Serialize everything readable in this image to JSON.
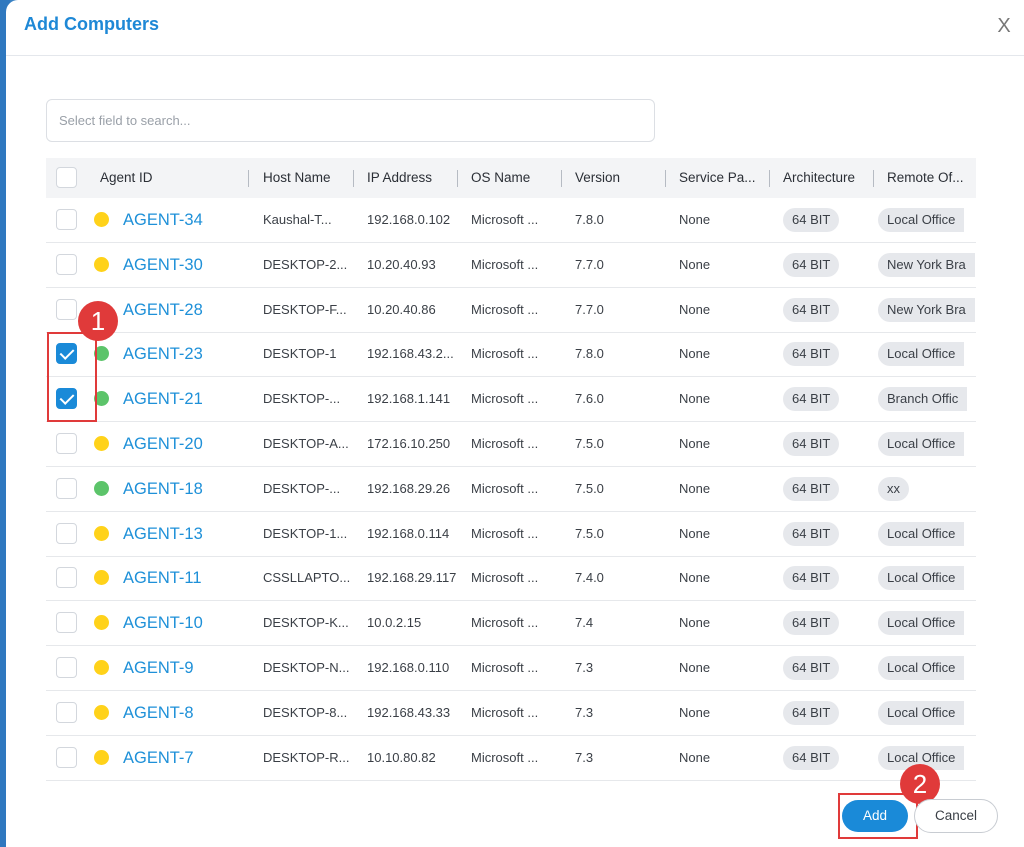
{
  "dialog": {
    "title": "Add Computers",
    "close_glyph": "X"
  },
  "search": {
    "placeholder": "Select field to search..."
  },
  "columns": [
    "Agent ID",
    "Host Name",
    "IP Address",
    "OS Name",
    "Version",
    "Service Pa...",
    "Architecture",
    "Remote Of..."
  ],
  "colors": {
    "online": "#5cc46a",
    "away": "#ffd21a",
    "accent": "#1a8ad8",
    "annotation": "#e03a3a"
  },
  "rows": [
    {
      "agent": "AGENT-34",
      "status": "away",
      "checked": false,
      "host": "Kaushal-T...",
      "ip": "192.168.0.102",
      "os": "Microsoft ...",
      "version": "7.8.0",
      "sp": "None",
      "arch": "64 BIT",
      "remote": "Local Office"
    },
    {
      "agent": "AGENT-30",
      "status": "away",
      "checked": false,
      "host": "DESKTOP-2...",
      "ip": "10.20.40.93",
      "os": "Microsoft ...",
      "version": "7.7.0",
      "sp": "None",
      "arch": "64 BIT",
      "remote": "New York Bra"
    },
    {
      "agent": "AGENT-28",
      "status": "away",
      "checked": false,
      "host": "DESKTOP-F...",
      "ip": "10.20.40.86",
      "os": "Microsoft ...",
      "version": "7.7.0",
      "sp": "None",
      "arch": "64 BIT",
      "remote": "New York Bra"
    },
    {
      "agent": "AGENT-23",
      "status": "online",
      "checked": true,
      "host": "DESKTOP-1",
      "ip": "192.168.43.2...",
      "os": "Microsoft ...",
      "version": "7.8.0",
      "sp": "None",
      "arch": "64 BIT",
      "remote": "Local Office"
    },
    {
      "agent": "AGENT-21",
      "status": "online",
      "checked": true,
      "host": "DESKTOP-...",
      "ip": "192.168.1.141",
      "os": "Microsoft ...",
      "version": "7.6.0",
      "sp": "None",
      "arch": "64 BIT",
      "remote": "Branch Offic"
    },
    {
      "agent": "AGENT-20",
      "status": "away",
      "checked": false,
      "host": "DESKTOP-A...",
      "ip": "172.16.10.250",
      "os": "Microsoft ...",
      "version": "7.5.0",
      "sp": "None",
      "arch": "64 BIT",
      "remote": "Local Office"
    },
    {
      "agent": "AGENT-18",
      "status": "online",
      "checked": false,
      "host": "DESKTOP-...",
      "ip": "192.168.29.26",
      "os": "Microsoft ...",
      "version": "7.5.0",
      "sp": "None",
      "arch": "64 BIT",
      "remote": "xx"
    },
    {
      "agent": "AGENT-13",
      "status": "away",
      "checked": false,
      "host": "DESKTOP-1...",
      "ip": "192.168.0.114",
      "os": "Microsoft ...",
      "version": "7.5.0",
      "sp": "None",
      "arch": "64 BIT",
      "remote": "Local Office"
    },
    {
      "agent": "AGENT-11",
      "status": "away",
      "checked": false,
      "host": "CSSLLAPTO...",
      "ip": "192.168.29.117",
      "os": "Microsoft ...",
      "version": "7.4.0",
      "sp": "None",
      "arch": "64 BIT",
      "remote": "Local Office"
    },
    {
      "agent": "AGENT-10",
      "status": "away",
      "checked": false,
      "host": "DESKTOP-K...",
      "ip": "10.0.2.15",
      "os": "Microsoft ...",
      "version": "7.4",
      "sp": "None",
      "arch": "64 BIT",
      "remote": "Local Office"
    },
    {
      "agent": "AGENT-9",
      "status": "away",
      "checked": false,
      "host": "DESKTOP-N...",
      "ip": "192.168.0.110",
      "os": "Microsoft ...",
      "version": "7.3",
      "sp": "None",
      "arch": "64 BIT",
      "remote": "Local Office"
    },
    {
      "agent": "AGENT-8",
      "status": "away",
      "checked": false,
      "host": "DESKTOP-8...",
      "ip": "192.168.43.33",
      "os": "Microsoft ...",
      "version": "7.3",
      "sp": "None",
      "arch": "64 BIT",
      "remote": "Local Office"
    },
    {
      "agent": "AGENT-7",
      "status": "away",
      "checked": false,
      "host": "DESKTOP-R...",
      "ip": "10.10.80.82",
      "os": "Microsoft ...",
      "version": "7.3",
      "sp": "None",
      "arch": "64 BIT",
      "remote": "Local Office"
    }
  ],
  "annotations": {
    "badge_1": "1",
    "badge_2": "2"
  },
  "footer": {
    "add_label": "Add",
    "cancel_label": "Cancel"
  }
}
